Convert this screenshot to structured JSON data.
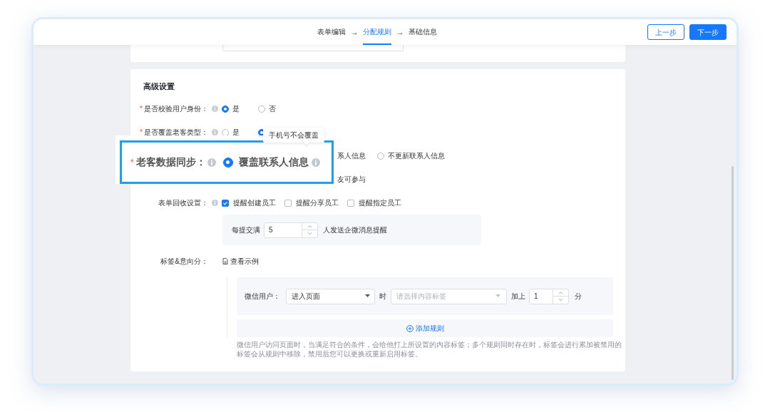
{
  "steps": [
    {
      "label": "表单编辑",
      "selected": false
    },
    {
      "label": "分配规则",
      "selected": true
    },
    {
      "label": "基础信息",
      "selected": false
    }
  ],
  "step_arrows": [
    "→",
    "→"
  ],
  "buttons": [
    {
      "label": "上一步",
      "kind": "secondary"
    },
    {
      "label": "下一步",
      "kind": "primary"
    }
  ],
  "section_title": "高级设置",
  "verify_identity": {
    "required_mark": "*",
    "label": "是否校验用户身份：",
    "info": true,
    "options": [
      {
        "label": "是",
        "selected": true
      },
      {
        "label": "否",
        "selected": false
      }
    ]
  },
  "cover_type": {
    "required_mark": "*",
    "label": "是否覆盖老客类型：",
    "info": true,
    "options": [
      {
        "label": "是",
        "selected": false
      },
      {
        "selected": true
      }
    ]
  },
  "sync_row": {
    "fragment": "系人信息",
    "options": [
      {
        "label": "不更新联系人信息",
        "selected": false
      }
    ]
  },
  "participate_row": {
    "fragment": "友可参与"
  },
  "recycle": {
    "label": "表单回收设置：",
    "info": true,
    "options": [
      {
        "label": "提醒创建员工",
        "checked": true
      },
      {
        "label": "提醒分享员工",
        "checked": false
      },
      {
        "label": "提醒指定员工",
        "checked": false
      }
    ],
    "threshold": {
      "prefix": "每提交满",
      "value": "5",
      "suffix": "人发送企微消息提醒"
    }
  },
  "tags": {
    "label": "标签&意向分：",
    "example_link": "查看示例",
    "rule": {
      "label": "微信用户：",
      "event": "进入页面",
      "when": "时",
      "tag_placeholder": "请选择内容标签",
      "add": "加上",
      "score": "1",
      "unit": "分"
    },
    "add_rule": "添加规则",
    "help": "微信用户访问页面时，当满足符合的条件，会给他打上所设置的内容标签；多个规则同时存在时，标签会进行累加被禁用的标签会从规则中移除，禁用后您可以更换或重新启用标签。"
  },
  "callout": {
    "required_mark": "*",
    "label": "老客数据同步：",
    "info": true,
    "option": {
      "label": "覆盖联系人信息",
      "selected": true,
      "info": true
    }
  },
  "tooltip": "手机号不会覆盖"
}
